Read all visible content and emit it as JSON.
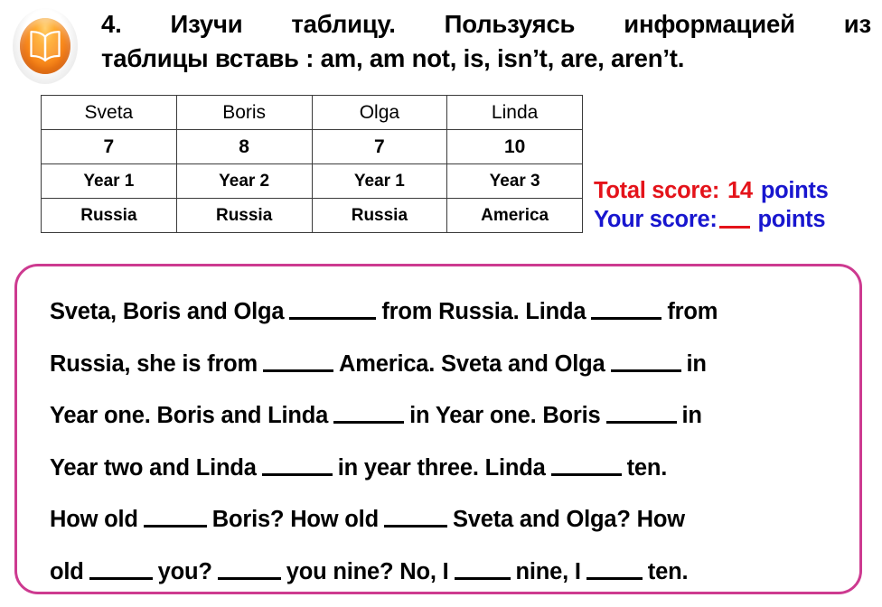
{
  "header": {
    "icon": "open-book-icon",
    "number": "4.",
    "line1_words": [
      "4.",
      "Изучи",
      "таблицу.",
      "Пользуясь",
      "информацией",
      "из"
    ],
    "line2": "таблицы вставь : am, am not, is, isn’t, are, aren’t.",
    "full_instruction": "4. Изучи таблицу. Пользуясь информацией из таблицы вставь : am, am not, is, isn’t, are, aren’t."
  },
  "table": {
    "rows": [
      [
        "Sveta",
        "Boris",
        "Olga",
        "Linda"
      ],
      [
        "7",
        "8",
        "7",
        "10"
      ],
      [
        "Year 1",
        "Year 2",
        "Year 1",
        "Year 3"
      ],
      [
        "Russia",
        "Russia",
        "Russia",
        "America"
      ]
    ]
  },
  "score": {
    "total_label": "Total score:",
    "total_value": "14",
    "total_unit": "points",
    "your_label": "Your score:",
    "your_value": "__",
    "your_unit": "points",
    "total_label_color": "#e4131a",
    "total_value_color": "#e4131a",
    "unit_color": "#1816cf",
    "your_color": "#1816cf"
  },
  "exercise": {
    "border_color": "#cd3a90",
    "lines": [
      {
        "id": "line-1",
        "parts": [
          "Sveta, Boris and Olga",
          "BLANK_XL",
          "from Russia. Linda",
          "BLANK_LG",
          "from"
        ],
        "text": "Sveta, Boris and Olga ______ from Russia. Linda _____ from"
      },
      {
        "id": "line-2",
        "parts": [
          "Russia, she is from",
          "BLANK_LG",
          "America. Sveta and Olga",
          "BLANK_LG",
          "in"
        ],
        "text": "Russia, she is from _____ America. Sveta and Olga _____ in"
      },
      {
        "id": "line-3",
        "parts": [
          "Year one. Boris and Linda",
          "BLANK_LG",
          "in Year one. Boris",
          "BLANK_LG",
          "in"
        ],
        "text": "Year one. Boris and Linda ______ in Year one. Boris ______ in"
      },
      {
        "id": "line-4",
        "parts": [
          "Year two and Linda",
          "BLANK_LG",
          "in year three. Linda",
          "BLANK_LG",
          "ten."
        ],
        "text": "Year two and Linda ______ in year three. Linda ______ ten."
      },
      {
        "id": "line-5",
        "parts": [
          "How old",
          "BLANK_MD",
          "Boris? How old",
          "BLANK_MD",
          "Sveta and Olga? How"
        ],
        "text": "How old ______ Boris? How old ______Sveta and Olga? How"
      },
      {
        "id": "line-6",
        "parts": [
          "old",
          "BLANK_MD",
          "you?",
          "BLANK_MD",
          "you nine? No, I",
          "BLANK_SM",
          "nine, I",
          "BLANK_SM",
          "ten."
        ],
        "text": "old ______you? _____ you nine? No, I _____nine, I _____ten."
      }
    ]
  }
}
